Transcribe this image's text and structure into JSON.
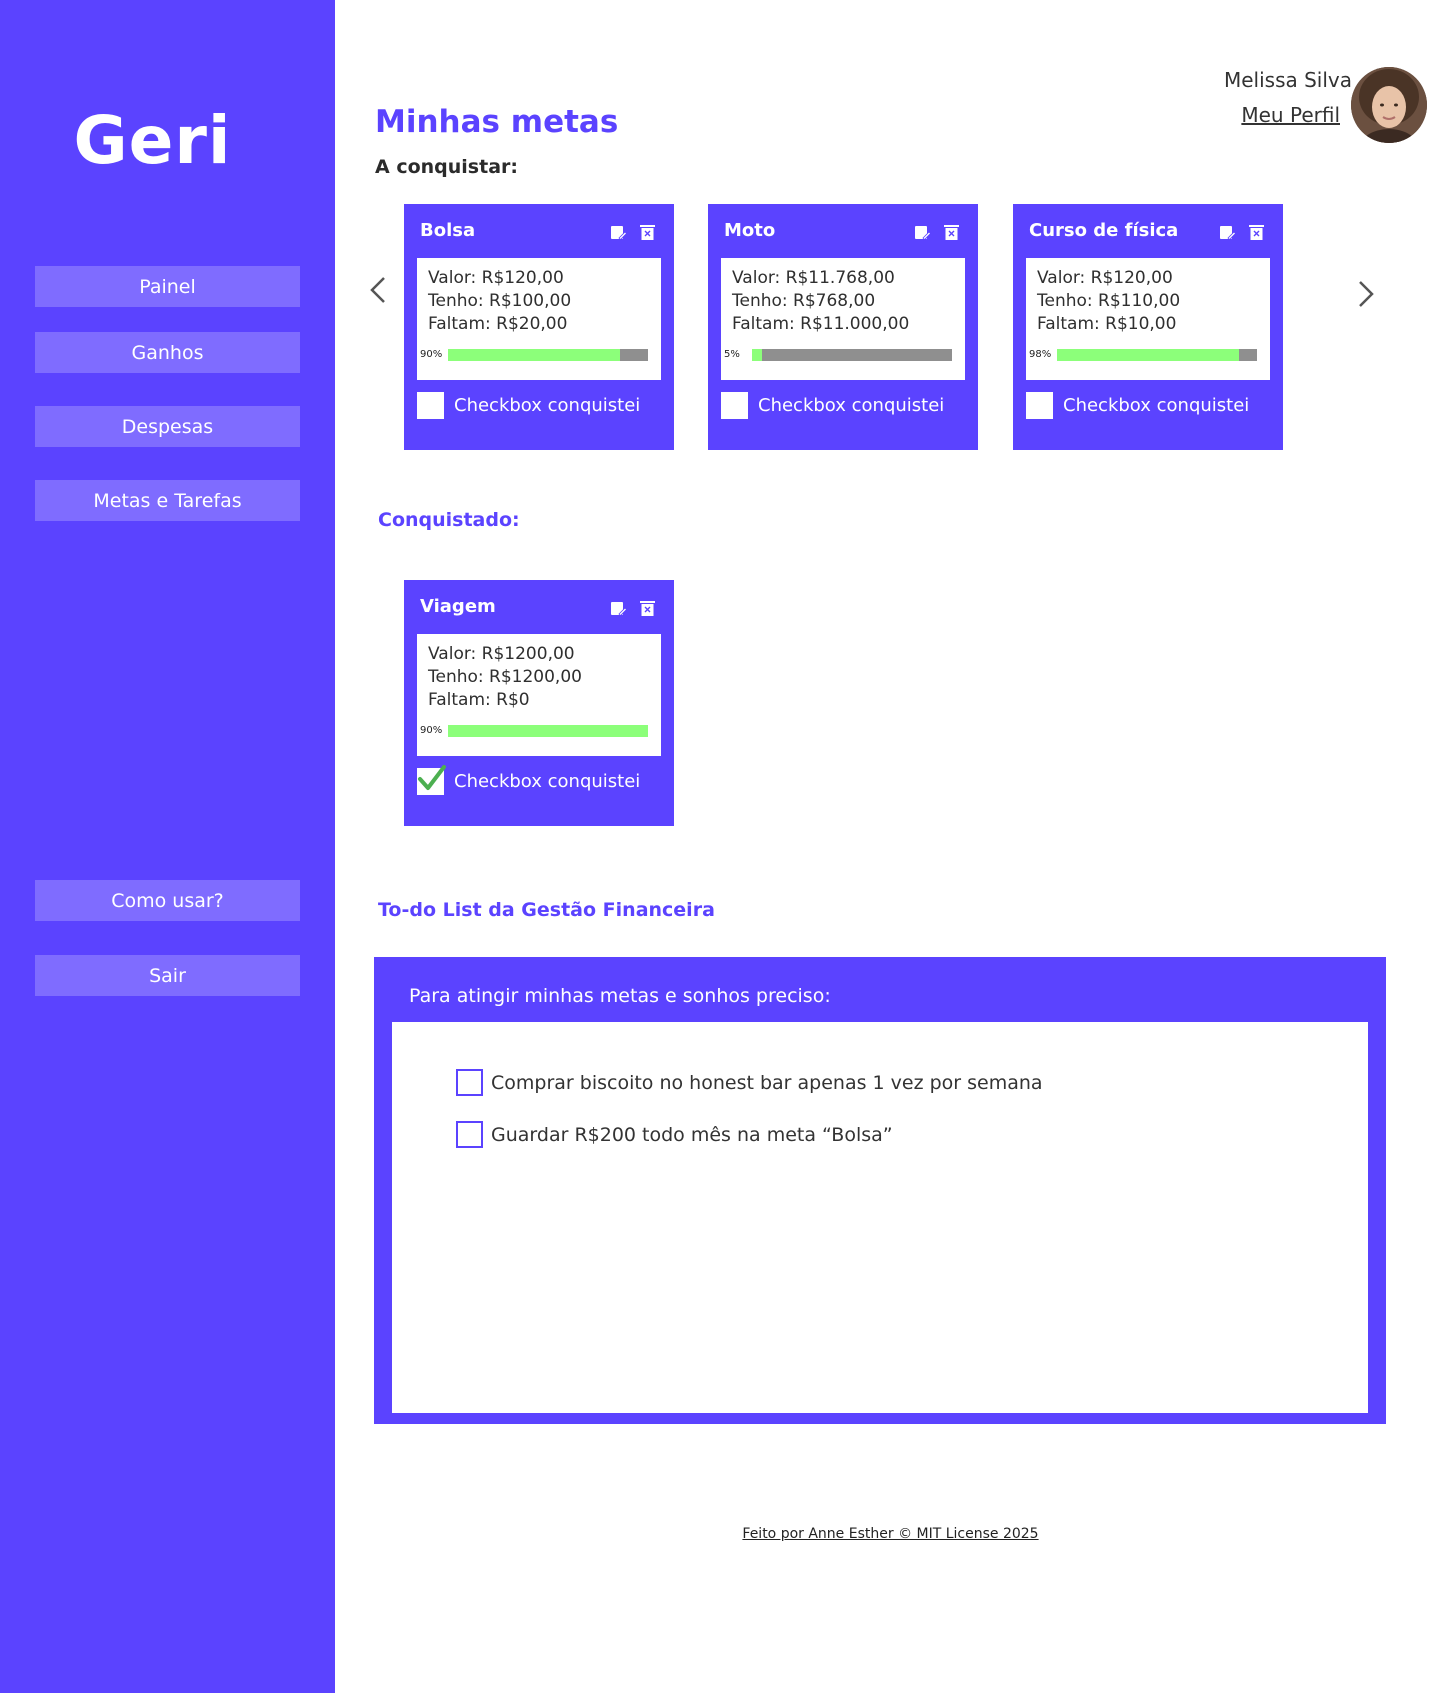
{
  "app": {
    "logo": "Geri",
    "nav": [
      "Painel",
      "Ganhos",
      "Despesas",
      "Metas e Tarefas"
    ],
    "nav_bottom": [
      "Como usar?",
      "Sair"
    ]
  },
  "user": {
    "name": "Melissa Silva",
    "profile_link": "Meu Perfil"
  },
  "page": {
    "title": "Minhas metas",
    "to_conquer": "A conquistar:",
    "conquered": "Conquistado:",
    "todo_title": "To-do List da Gestão Financeira"
  },
  "goals_pending": [
    {
      "title": "Bolsa",
      "valor": "Valor: R$120,00",
      "tenho": "Tenho: R$100,00",
      "faltam": "Faltam: R$20,00",
      "pct_label": "90%",
      "progress": 0.86,
      "checked": false,
      "check_label": "Checkbox conquistei"
    },
    {
      "title": "Moto",
      "valor": "Valor: R$11.768,00",
      "tenho": "Tenho: R$768,00",
      "faltam": "Faltam: R$11.000,00",
      "pct_label": "5%",
      "progress": 0.05,
      "checked": false,
      "check_label": "Checkbox conquistei"
    },
    {
      "title": "Curso de física",
      "valor": "Valor: R$120,00",
      "tenho": "Tenho: R$110,00",
      "faltam": "Faltam: R$10,00",
      "pct_label": "98%",
      "progress": 0.91,
      "checked": false,
      "check_label": "Checkbox conquistei"
    }
  ],
  "goals_done": [
    {
      "title": "Viagem",
      "valor": "Valor: R$1200,00",
      "tenho": "Tenho: R$1200,00",
      "faltam": "Faltam: R$0",
      "pct_label": "90%",
      "progress": 1.0,
      "checked": true,
      "check_label": "Checkbox conquistei"
    }
  ],
  "todo": {
    "header": "Para atingir minhas metas e sonhos preciso:",
    "items": [
      {
        "text": "Comprar biscoito no honest bar apenas 1 vez por semana",
        "checked": false
      },
      {
        "text": "Guardar R$200 todo mês na meta “Bolsa”",
        "checked": false
      }
    ]
  },
  "footer": "Feito por Anne Esther © MIT License 2025",
  "colors": {
    "primary": "#5b43ff",
    "nav_button": "#7f6cff",
    "progress_fill": "#8cff7a",
    "progress_track": "#8f8f8f"
  },
  "icons": [
    "edit-icon",
    "delete-icon",
    "chevron-left-icon",
    "chevron-right-icon",
    "checkmark-icon"
  ]
}
